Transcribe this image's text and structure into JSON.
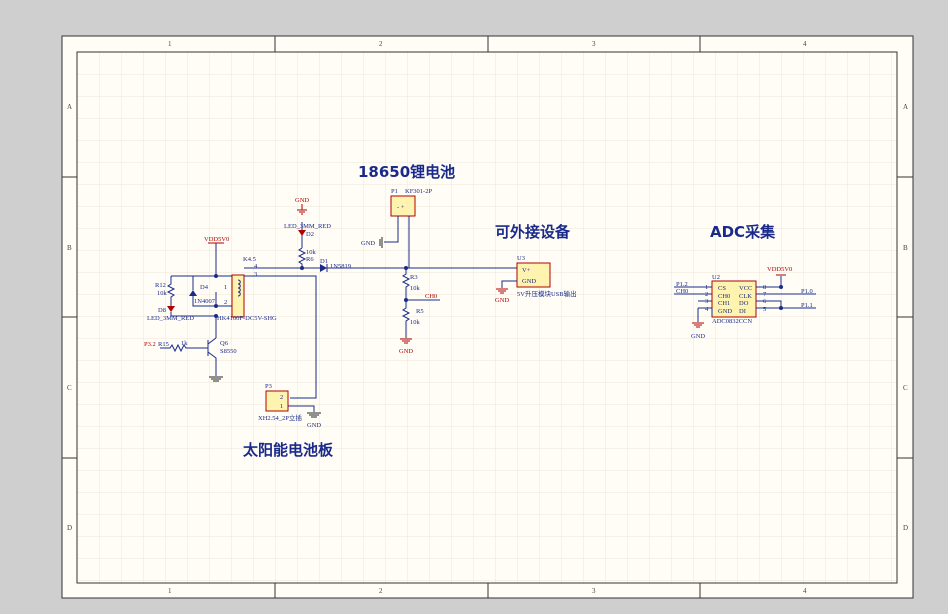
{
  "zones": {
    "cols": [
      "1",
      "2",
      "3",
      "4"
    ],
    "rows": [
      "A",
      "B",
      "C",
      "D"
    ]
  },
  "titles": {
    "battery": "18650锂电池",
    "external": "可外接设备",
    "adc": "ADC采集",
    "solar": "太阳能电池板"
  },
  "parts": {
    "p1": "P1",
    "p1_val": "KF301-2P",
    "u3": "U3",
    "u3_vplus": "V+",
    "u3_gnd": "GND",
    "u3_val": "5V升压模块USB输出",
    "u2": "U2",
    "u2_val": "ADC0832CCN",
    "u2_pins_left": [
      "CS",
      "CH0",
      "CH1",
      "GND"
    ],
    "u2_pins_right": [
      "VCC",
      "CLK",
      "DO",
      "DI"
    ],
    "u2_num_left": [
      "1",
      "2",
      "3",
      "4"
    ],
    "u2_num_right": [
      "8",
      "7",
      "6",
      "5"
    ],
    "u2_nets": {
      "p12": "P1.2",
      "ch0": "CH0",
      "p10": "P1.0",
      "p11": "P1.1"
    },
    "vdd": "VDD5V0",
    "gnd": "GND",
    "d2": "D2",
    "d2_val": "LED_3MM_RED",
    "r6": "R6",
    "r6_val": "10k",
    "d1": "D1",
    "d1_val": "1N5819",
    "r3": "R3",
    "r3_val": "10k",
    "r5": "R5",
    "r5_val": "10k",
    "ch0": "CH0",
    "k": "K4.5",
    "k_pins": [
      "4",
      "3",
      "2",
      "1"
    ],
    "k_val": "HK4100F-DC5V-SHG",
    "d4": "D4",
    "d4_val": "1N4007",
    "r12": "R12",
    "r12_val": "10k",
    "d8": "D8",
    "d8_val": "LED_3MM_RED",
    "q6": "Q6",
    "q6_val": "S8550",
    "r15": "R15",
    "r15_val": "1k",
    "p32": "P3.2",
    "p3": "P3",
    "p3_val": "XH2.54_2P立插",
    "p3_pins": [
      "2",
      "1"
    ]
  }
}
